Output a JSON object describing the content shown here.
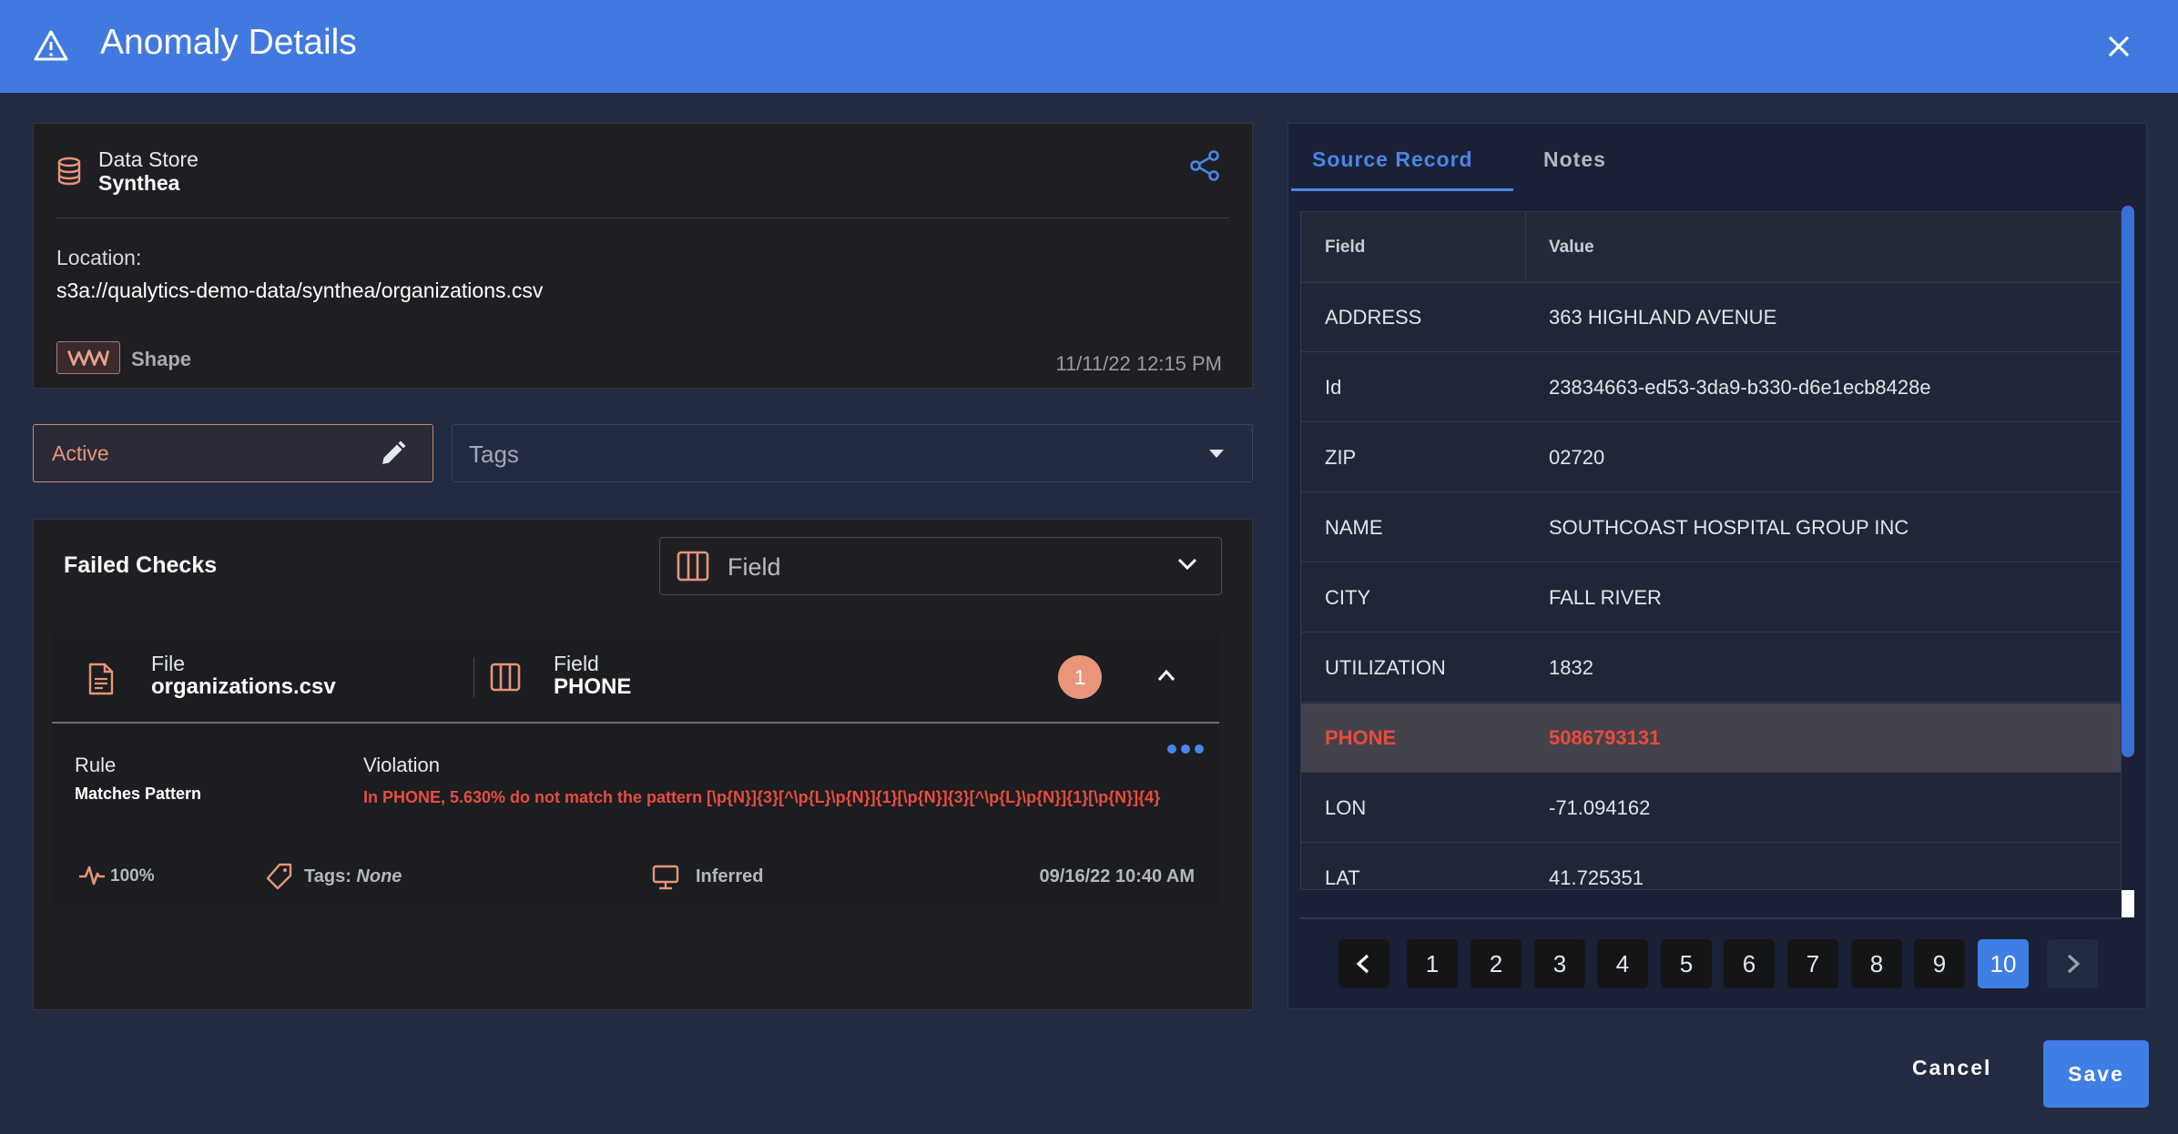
{
  "header": {
    "title": "Anomaly Details"
  },
  "datastore": {
    "label": "Data Store",
    "name": "Synthea",
    "location_label": "Location:",
    "location_value": "s3a://qualytics-demo-data/synthea/organizations.csv",
    "shape_label": "Shape",
    "timestamp": "11/11/22 12:15 PM"
  },
  "status": {
    "value": "Active"
  },
  "tags": {
    "placeholder": "Tags"
  },
  "failed_checks": {
    "title": "Failed Checks",
    "group_by": "Field",
    "card": {
      "file_label": "File",
      "file_value": "organizations.csv",
      "field_label": "Field",
      "field_value": "PHONE",
      "count": "1",
      "rule_label": "Rule",
      "rule_value": "Matches Pattern",
      "violation_label": "Violation",
      "violation_value": "In PHONE, 5.630% do not match the pattern [\\p{N}]{3}[^\\p{L}\\p{N}]{1}[\\p{N}]{3}[^\\p{L}\\p{N}]{1}[\\p{N}]{4}",
      "coverage": "100%",
      "tags_label": "Tags:",
      "tags_value": "None",
      "source": "Inferred",
      "timestamp": "09/16/22 10:40 AM"
    }
  },
  "source_record": {
    "tabs": [
      "Source Record",
      "Notes"
    ],
    "columns": [
      "Field",
      "Value"
    ],
    "rows": [
      {
        "field": "ADDRESS",
        "value": "363 HIGHLAND AVENUE"
      },
      {
        "field": "Id",
        "value": "23834663-ed53-3da9-b330-d6e1ecb8428e"
      },
      {
        "field": "ZIP",
        "value": "02720"
      },
      {
        "field": "NAME",
        "value": "SOUTHCOAST HOSPITAL GROUP INC"
      },
      {
        "field": "CITY",
        "value": "FALL RIVER"
      },
      {
        "field": "UTILIZATION",
        "value": "1832"
      },
      {
        "field": "PHONE",
        "value": "5086793131"
      },
      {
        "field": "LON",
        "value": "-71.094162"
      },
      {
        "field": "LAT",
        "value": "41.725351"
      }
    ],
    "highlighted_field": "PHONE",
    "pages": [
      "1",
      "2",
      "3",
      "4",
      "5",
      "6",
      "7",
      "8",
      "9",
      "10"
    ],
    "current_page": "10"
  },
  "actions": {
    "cancel": "Cancel",
    "save": "Save"
  },
  "colors": {
    "accent": "#4179e0",
    "violation": "#e84d3d",
    "status": "#e69577",
    "badge": "#e9957a"
  }
}
